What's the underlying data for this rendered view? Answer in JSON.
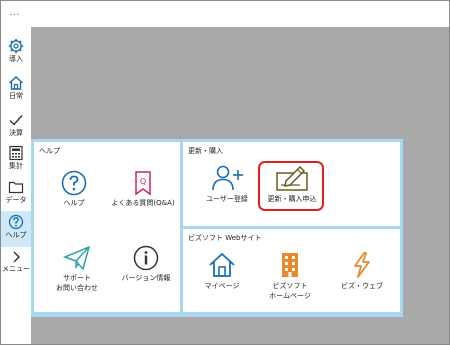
{
  "window": {
    "menu_dots": "…"
  },
  "sidebar": {
    "items": [
      {
        "label": "導入",
        "icon": "gear-icon"
      },
      {
        "label": "日常",
        "icon": "home-icon"
      },
      {
        "label": "決算",
        "icon": "check-icon"
      },
      {
        "label": "集計",
        "icon": "calculator-icon"
      },
      {
        "label": "データ",
        "icon": "folder-icon"
      },
      {
        "label": "ヘルプ",
        "icon": "question-icon",
        "active": true
      },
      {
        "label": "メニュー",
        "icon": "chevron-right-icon"
      }
    ]
  },
  "help": {
    "title": "ヘルプ",
    "tiles": [
      {
        "label": "ヘルプ",
        "icon": "question-circle-icon"
      },
      {
        "label": "よくある質問(Q&A)",
        "icon": "bookmark-q-icon"
      },
      {
        "label_line1": "サポート",
        "label_line2": "お問い合わせ",
        "icon": "paper-plane-icon"
      },
      {
        "label": "バージョン情報",
        "icon": "info-circle-icon"
      }
    ]
  },
  "update": {
    "title": "更新・購入",
    "tiles": [
      {
        "label": "ユーザー登録",
        "icon": "user-add-icon"
      },
      {
        "label": "更新・購入申込",
        "icon": "pencil-form-icon",
        "highlighted": true
      }
    ]
  },
  "web": {
    "title": "ビズソフト Webサイト",
    "tiles": [
      {
        "label": "マイページ",
        "icon": "house-icon"
      },
      {
        "label_line1": "ビズソフト",
        "label_line2": "ホームページ",
        "icon": "building-icon"
      },
      {
        "label": "ビズ・ウェブ",
        "icon": "lightning-icon"
      }
    ]
  },
  "colors": {
    "accent_blue": "#1a6fb0",
    "panel_blue": "#a8d8ef",
    "highlight_red": "#e02020",
    "building_orange": "#e8892a",
    "icon_olive": "#6b5a1e",
    "bookmark_red": "#d0245a",
    "plane_teal": "#2aa6a0",
    "background_gray": "#a8a8a8"
  }
}
